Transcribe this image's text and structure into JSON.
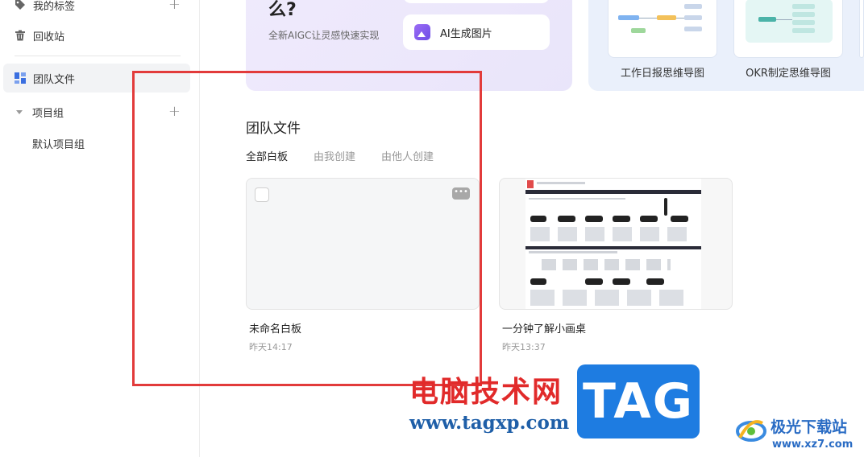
{
  "sidebar": {
    "tags_label": "我的标签",
    "recycle_label": "回收站",
    "team_files_label": "团队文件",
    "project_group_label": "项目组",
    "default_project_group_label": "默认项目组",
    "plus": "+"
  },
  "banner": {
    "question_tail": "么?",
    "subtitle": "全新AIGC让灵感快速实现",
    "ai_image_button": "AI生成图片"
  },
  "templates": [
    {
      "label": "工作日报思维导图"
    },
    {
      "label": "OKR制定思维导图"
    }
  ],
  "main": {
    "section_title": "团队文件",
    "tabs": [
      "全部白板",
      "由我创建",
      "由他人创建"
    ],
    "files": [
      {
        "name": "未命名白板",
        "time": "昨天14:17"
      },
      {
        "name": "一分钟了解小画桌",
        "time": "昨天13:37"
      }
    ],
    "more_label": "•••"
  },
  "watermark": {
    "site_cn": "电脑技术网",
    "site_url": "www.tagxp.com",
    "tag": "TAG",
    "jg_title": "极光下载站",
    "jg_url": "www.xz7.com"
  },
  "colors": {
    "highlight": "#e23b3b",
    "tag_bg": "#1e7ce1",
    "banner_purple": "#ece7fb",
    "banner_blue": "#eaf0fb"
  }
}
